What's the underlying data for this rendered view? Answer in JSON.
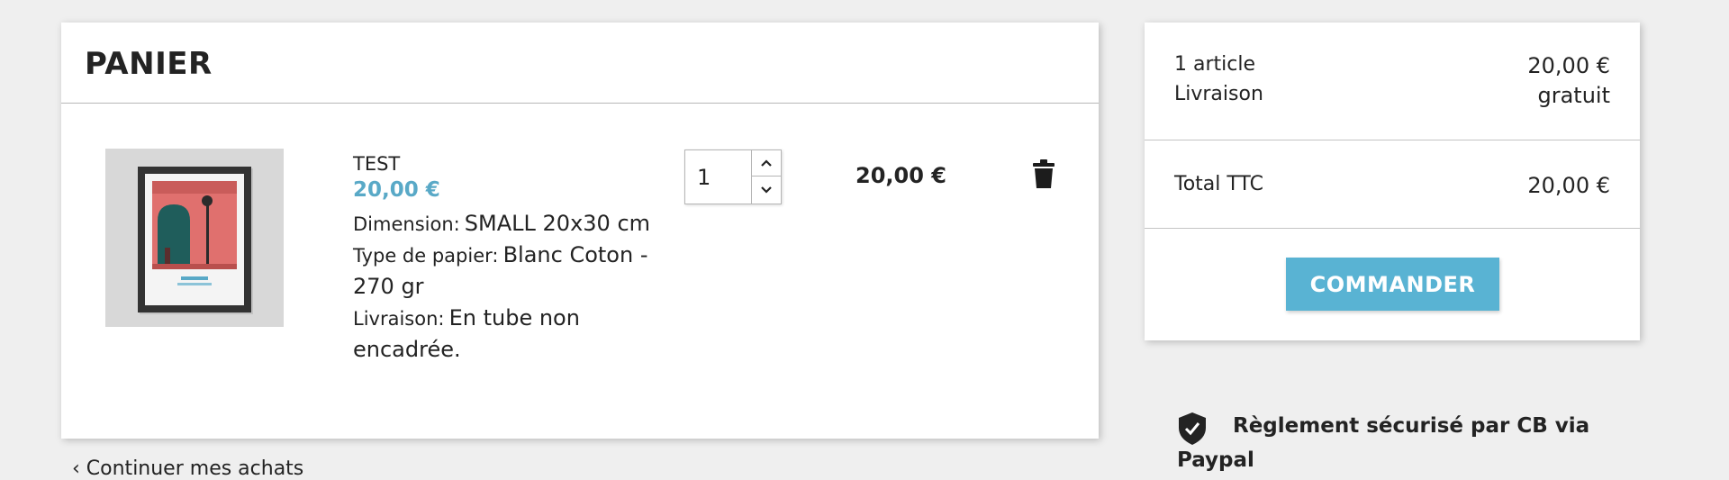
{
  "cart": {
    "title": "PANIER",
    "item": {
      "name": "TEST",
      "unit_price": "20,00 €",
      "attributes": [
        {
          "label": "Dimension:",
          "value": "SMALL 20x30 cm"
        },
        {
          "label": "Type de papier:",
          "value": "Blanc Coton - 270 gr"
        },
        {
          "label": "Livraison:",
          "value": "En tube non encadrée."
        }
      ],
      "quantity": "1",
      "line_total": "20,00 €",
      "delete_icon": "trash-icon"
    },
    "continue_label": "Continuer mes achats",
    "continue_icon": "chevron-left-icon"
  },
  "summary": {
    "items_label": "1 article",
    "items_value": "20,00 €",
    "shipping_label": "Livraison",
    "shipping_value": "gratuit",
    "total_label": "Total TTC",
    "total_value": "20,00 €",
    "order_button": "COMMANDER"
  },
  "secure": {
    "icon": "shield-check-icon",
    "text_line1": "Règlement sécurisé par CB via",
    "text_line2": "Paypal"
  },
  "colors": {
    "accent": "#59b3d3",
    "price": "#59a9c7",
    "background": "#efefef"
  }
}
